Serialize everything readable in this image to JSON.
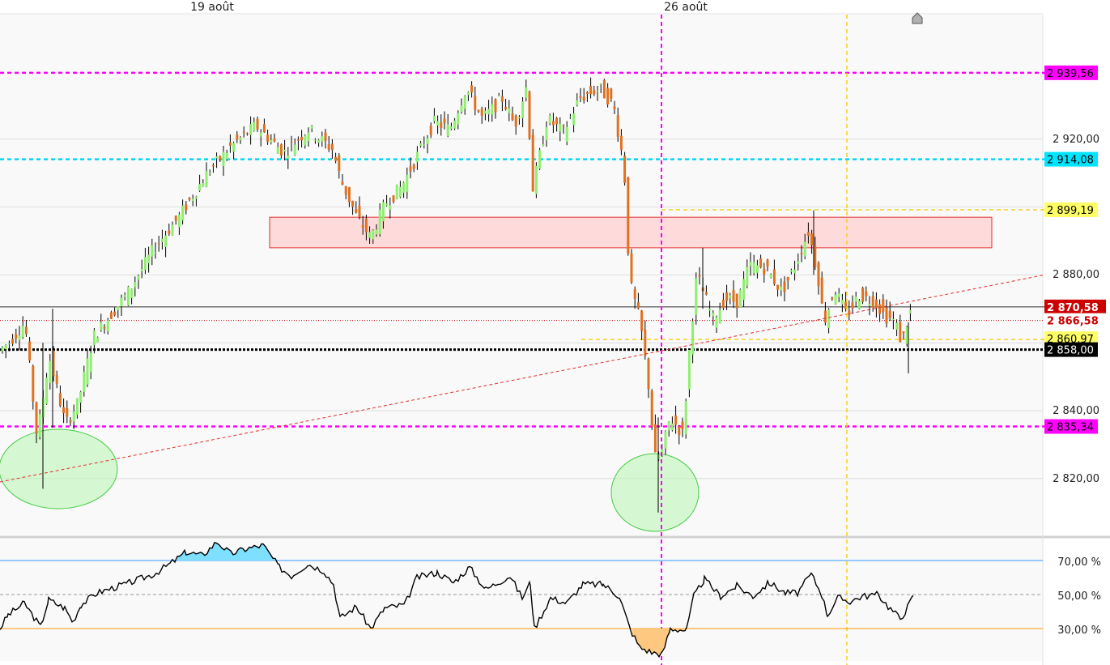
{
  "chart_data": {
    "type": "candlestick",
    "date_labels": [
      "19 août",
      "26 août"
    ],
    "price_axis": {
      "ticks": [
        "2 920,00",
        "2 880,00",
        "2 840,00",
        "2 820,00"
      ],
      "tick_values": [
        2920,
        2880,
        2840,
        2820
      ],
      "range": [
        2811,
        2945
      ]
    },
    "price_tags": [
      {
        "label": "2 939,56",
        "value": 2939.56,
        "bg": "#ff00ff",
        "fg": "#000000"
      },
      {
        "label": "2 914,08",
        "value": 2914.08,
        "bg": "#00e5ff",
        "fg": "#000000"
      },
      {
        "label": "2 899,19",
        "value": 2899.19,
        "bg": "#ffff66",
        "fg": "#000000"
      },
      {
        "label": "2 870,58",
        "value": 2870.58,
        "bg": "#cc0000",
        "fg": "#ffffff"
      },
      {
        "label": "2 866,58",
        "value": 2866.58,
        "bg": "#ffffff",
        "fg": "#cc0000"
      },
      {
        "label": "2 860,97",
        "value": 2860.97,
        "bg": "#ffff66",
        "fg": "#000000"
      },
      {
        "label": "2 858,00",
        "value": 2858.0,
        "bg": "#000000",
        "fg": "#ffffff"
      },
      {
        "label": "2 835,34",
        "value": 2835.34,
        "bg": "#ff00ff",
        "fg": "#000000"
      }
    ],
    "resistance_zone": [
      2888,
      2897
    ],
    "trendline": {
      "start": [
        0,
        2819
      ],
      "end": [
        1290,
        2880
      ]
    },
    "indicator": {
      "ticks": [
        "70,00 %",
        "50,00 %",
        "30,00 %"
      ],
      "tick_values": [
        70,
        50,
        30
      ],
      "range": [
        10,
        90
      ]
    },
    "colors": {
      "up": "#90ee70",
      "down": "#e07020",
      "wick": "#000000",
      "magenta": "#ff00ff",
      "cyan": "#00d8f0",
      "yellow": "#f5d020",
      "trend": "#e03030",
      "zone_fill": "#ffdada",
      "zone_border": "#e03030",
      "circle_fill": "#b8f5b0",
      "circle_border": "#44cc44"
    }
  }
}
